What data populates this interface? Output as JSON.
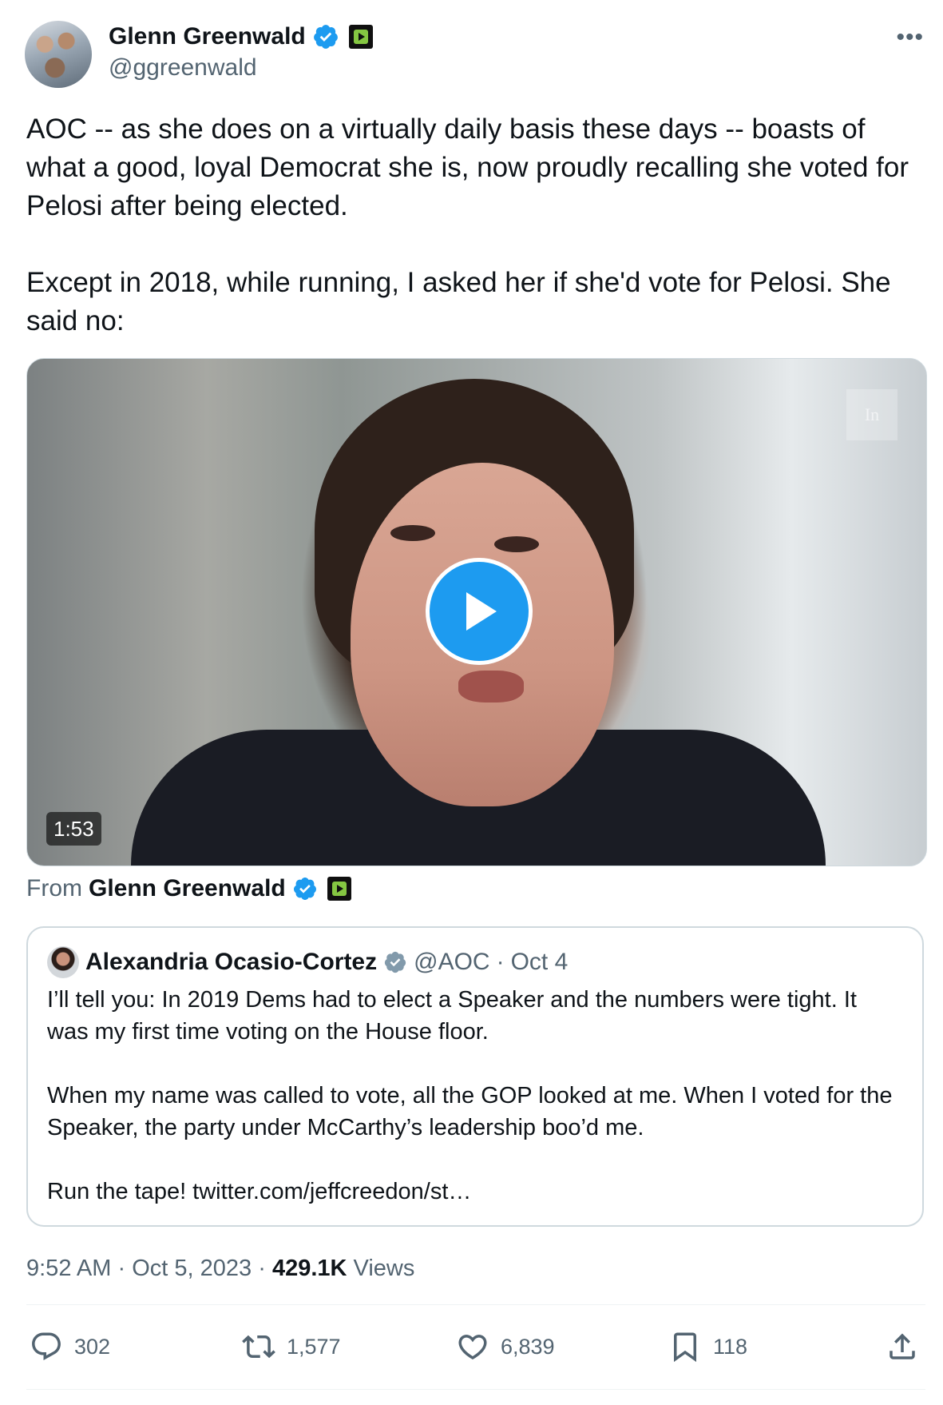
{
  "author": {
    "name": "Glenn Greenwald",
    "handle": "@ggreenwald",
    "more_label": "•••"
  },
  "tweet": {
    "text": "AOC -- as she does on a virtually daily basis these days -- boasts of what a good, loyal Democrat she is, now proudly recalling she voted for Pelosi after being elected.\n\nExcept in 2018, while running, I asked her if she'd vote for Pelosi. She said no:"
  },
  "video": {
    "duration": "1:53",
    "watermark": "In"
  },
  "from": {
    "label": "From",
    "name": "Glenn Greenwald"
  },
  "quote": {
    "name": "Alexandria Ocasio-Cortez",
    "handle": "@AOC",
    "separator": "·",
    "date": "Oct 4",
    "text": "I’ll tell you: In 2019 Dems had to elect a Speaker and the numbers were tight. It was my first time voting on the House floor.\n\nWhen my name was called to vote, all the GOP looked at me. When I voted for the Speaker, the party under McCarthy’s leadership boo’d me.\n\nRun the tape! twitter.com/jeffcreedon/st…"
  },
  "meta": {
    "time": "9:52 AM",
    "date": "Oct 5, 2023",
    "separator": "·",
    "views_count": "429.1K",
    "views_label": "Views"
  },
  "actions": {
    "replies": "302",
    "reposts": "1,577",
    "likes": "6,839",
    "bookmarks": "118"
  },
  "colors": {
    "accent": "#1d9bf0",
    "text": "#0f1419",
    "secondary": "#536471",
    "border": "#cfd9de"
  },
  "icons": [
    "verified-badge-icon",
    "rumble-icon",
    "more-icon",
    "play-icon",
    "reply-icon",
    "repost-icon",
    "like-icon",
    "bookmark-icon",
    "share-icon"
  ]
}
